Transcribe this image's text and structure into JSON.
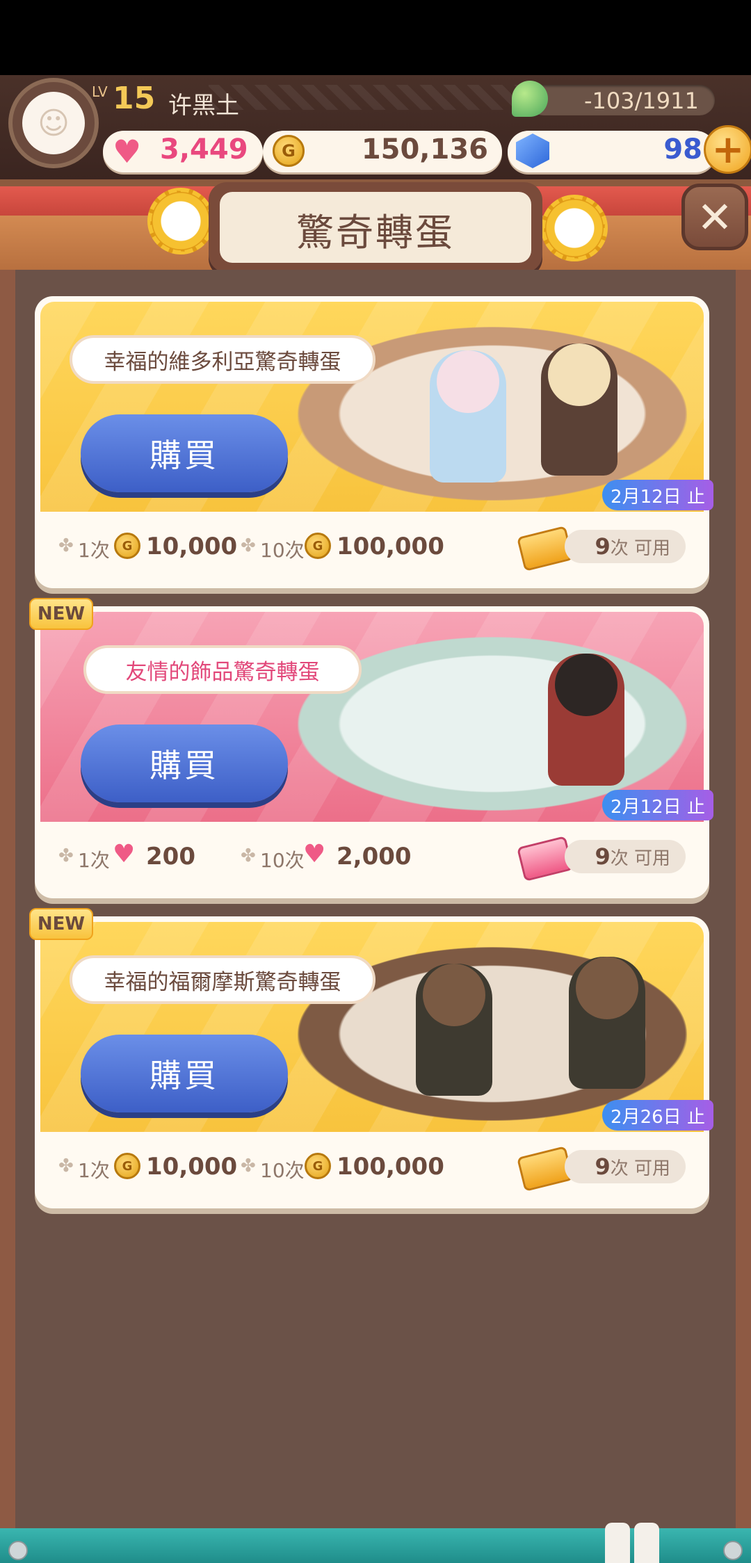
{
  "hud": {
    "lv_tag": "LV",
    "level": "15",
    "user_name": "许黑土",
    "energy": "-103/1911",
    "hearts": "3,449",
    "coins": "150,136",
    "gems": "98",
    "plus_label": "+"
  },
  "header": {
    "title": "驚奇轉蛋",
    "close_label": "✕"
  },
  "cards": [
    {
      "name": "幸福的維多利亞驚奇轉蛋",
      "buy_label": "購買",
      "end_date": "2月12日 止",
      "is_new": false,
      "currency": "coin",
      "single_label": "1次",
      "single_price": "10,000",
      "ten_label": "10次",
      "ten_price": "100,000",
      "ticket_count": "9",
      "ticket_suffix": "次 可用"
    },
    {
      "name": "友情的飾品驚奇轉蛋",
      "buy_label": "購買",
      "end_date": "2月12日 止",
      "is_new": true,
      "new_label": "NEW",
      "currency": "heart",
      "single_label": "1次",
      "single_price": "200",
      "ten_label": "10次",
      "ten_price": "2,000",
      "ticket_count": "9",
      "ticket_suffix": "次 可用"
    },
    {
      "name": "幸福的福爾摩斯驚奇轉蛋",
      "buy_label": "購買",
      "end_date": "2月26日 止",
      "is_new": true,
      "new_label": "NEW",
      "currency": "coin",
      "single_label": "1次",
      "single_price": "10,000",
      "ten_label": "10次",
      "ten_price": "100,000",
      "ticket_count": "9",
      "ticket_suffix": "次 可用"
    }
  ],
  "colors": {
    "accent_blue": "#3d5fc7",
    "heart_pink": "#ef5a86",
    "coin_gold": "#e3a316",
    "panel_brown": "#6b5248"
  }
}
